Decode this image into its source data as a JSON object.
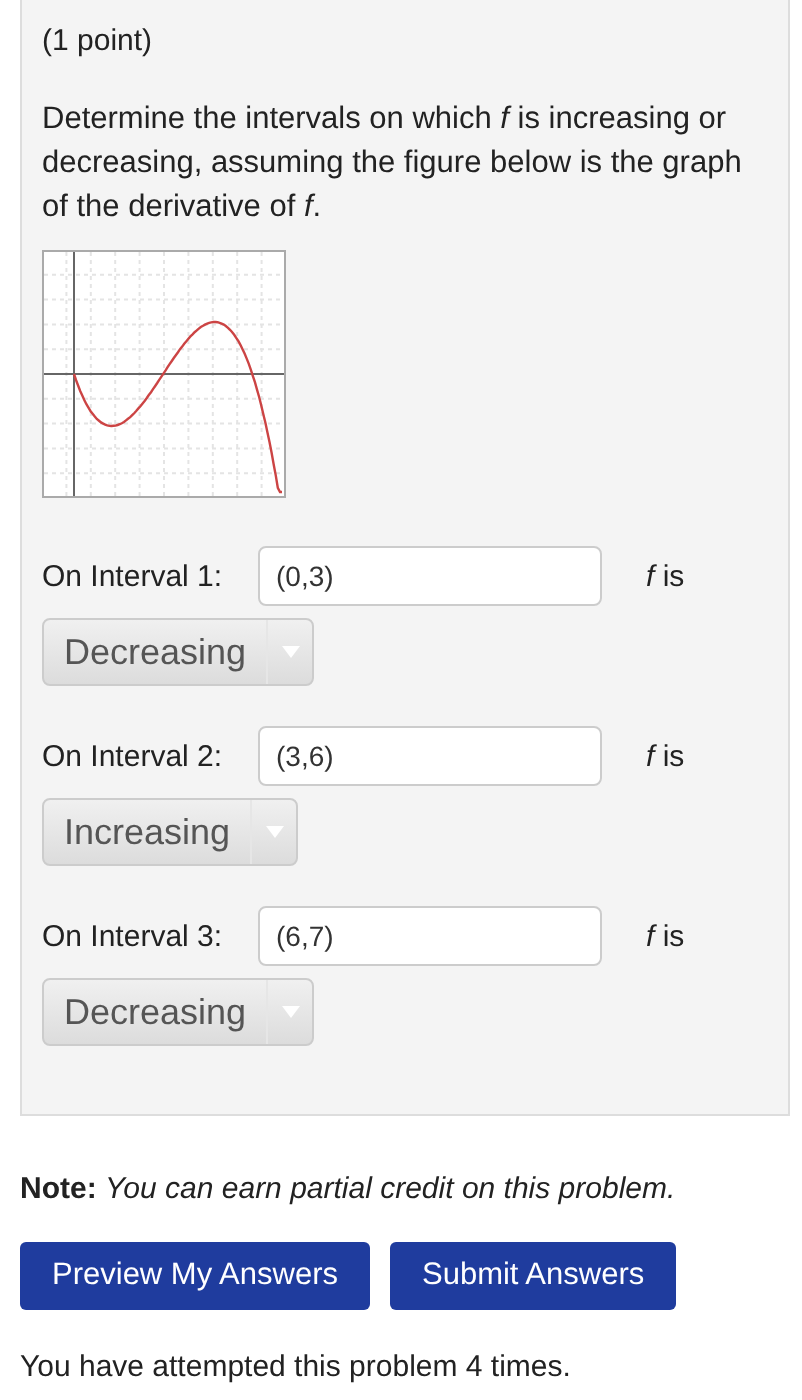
{
  "problem": {
    "points": "(1 point)",
    "question": "Determine the intervals on which *f* is increasing or decreasing, assuming the figure below is the graph of the derivative of *f*.",
    "intervals": [
      {
        "label": "On Interval 1:",
        "value": "(0,3)",
        "suffix": "*f* is",
        "choice": "Decreasing"
      },
      {
        "label": "On Interval 2:",
        "value": "(3,6)",
        "suffix": "*f* is",
        "choice": "Increasing"
      },
      {
        "label": "On Interval 3:",
        "value": "(6,7)",
        "suffix": "*f* is",
        "choice": "Decreasing"
      }
    ]
  },
  "note": "**Note:** *You can earn partial credit on this problem.*",
  "buttons": [
    "Preview My Answers",
    "Submit Answers"
  ],
  "attempts": "You have attempted this problem 4 times."
}
